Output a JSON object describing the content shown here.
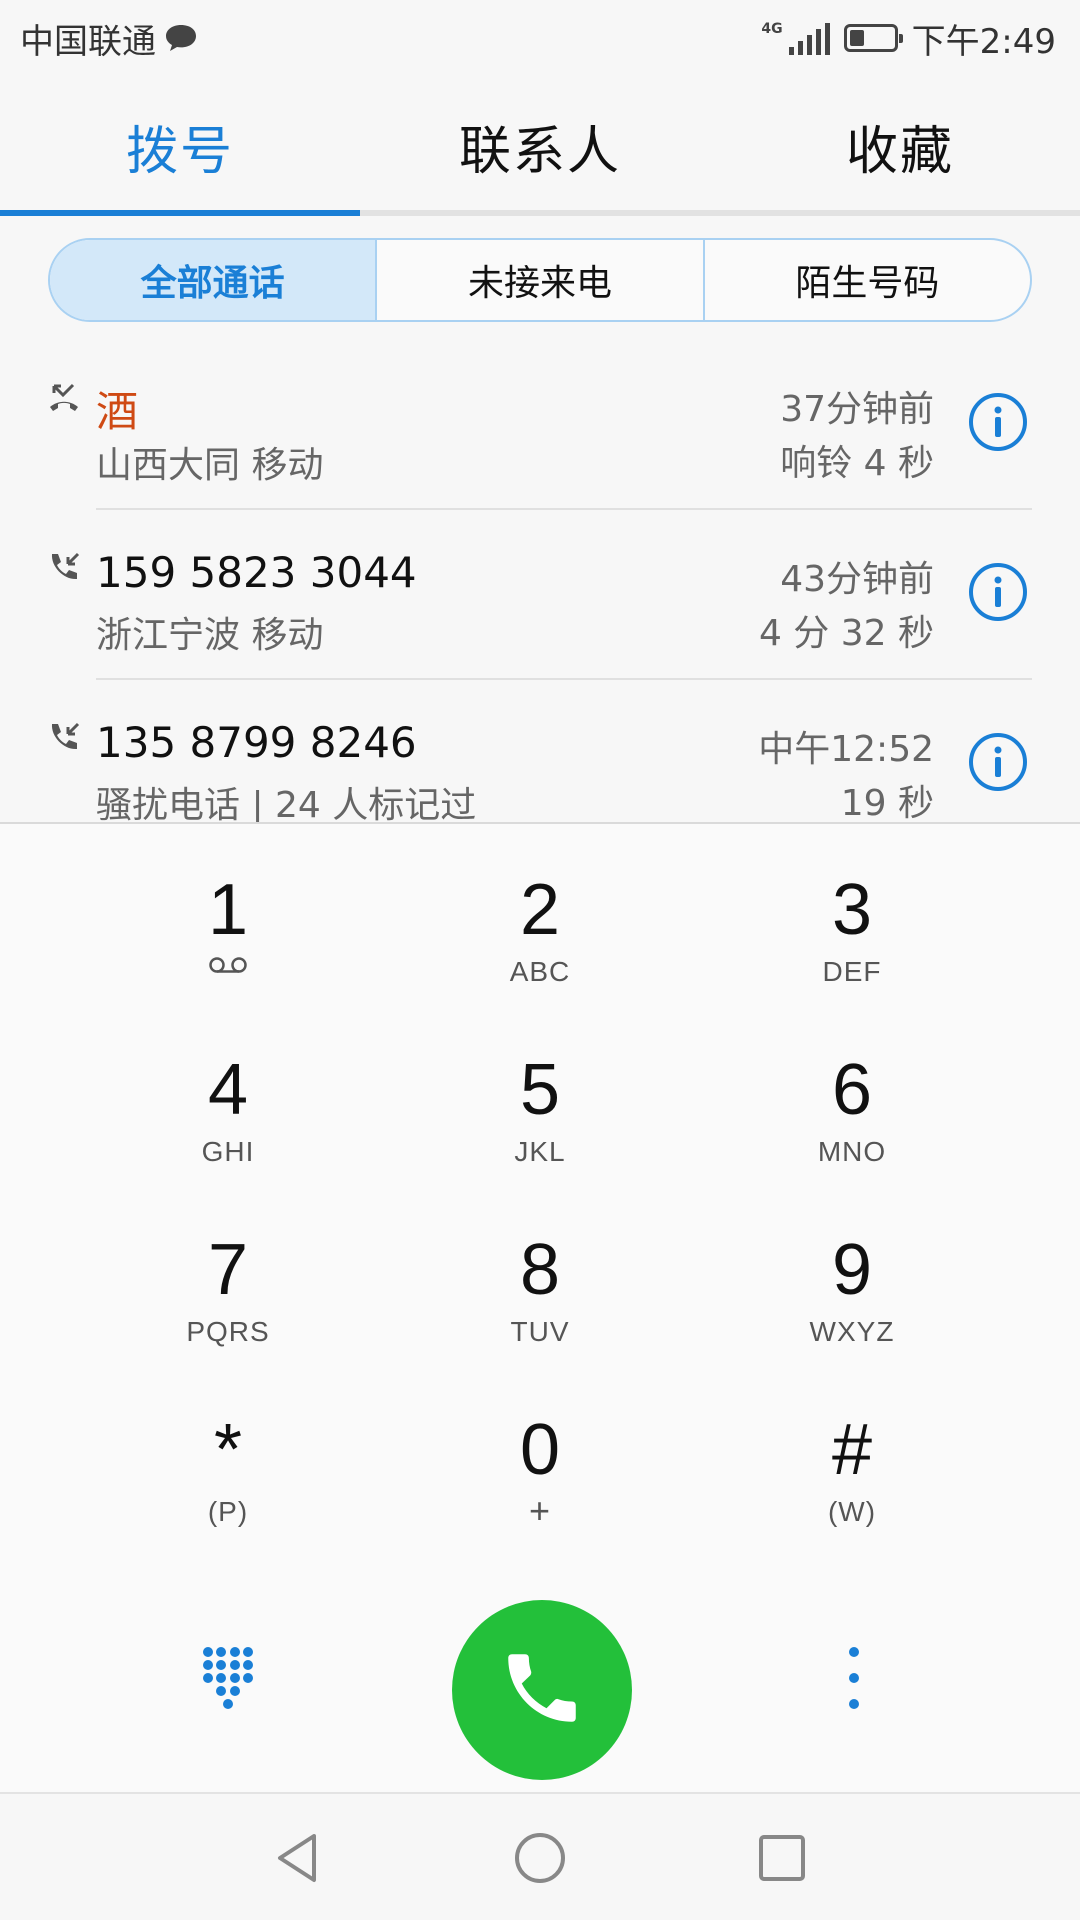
{
  "status_bar": {
    "carrier": "中国联通",
    "network": "4G",
    "time": "下午2:49",
    "battery_level": 0.35
  },
  "tabs": [
    {
      "label": "拨号",
      "active": true
    },
    {
      "label": "联系人",
      "active": false
    },
    {
      "label": "收藏",
      "active": false
    }
  ],
  "filters": [
    {
      "label": "全部通话",
      "active": true
    },
    {
      "label": "未接来电",
      "active": false
    },
    {
      "label": "陌生号码",
      "active": false
    }
  ],
  "calls": [
    {
      "name": "酒",
      "location": "山西大同 移动",
      "time": "37分钟前",
      "duration": "响铃 4 秒",
      "type": "missed",
      "icon": "missed-call-icon"
    },
    {
      "name": "159 5823 3044",
      "location": "浙江宁波 移动",
      "time": "43分钟前",
      "duration": "4 分 32 秒",
      "type": "incoming",
      "icon": "incoming-call-icon"
    },
    {
      "name": "135 8799 8246",
      "location": "骚扰电话 | 24 人标记过",
      "time": "中午12:52",
      "duration": "19 秒",
      "type": "incoming",
      "icon": "incoming-call-icon"
    }
  ],
  "keypad": [
    {
      "digit": "1",
      "letters": "",
      "icon": "voicemail-icon"
    },
    {
      "digit": "2",
      "letters": "ABC"
    },
    {
      "digit": "3",
      "letters": "DEF"
    },
    {
      "digit": "4",
      "letters": "GHI"
    },
    {
      "digit": "5",
      "letters": "JKL"
    },
    {
      "digit": "6",
      "letters": "MNO"
    },
    {
      "digit": "7",
      "letters": "PQRS"
    },
    {
      "digit": "8",
      "letters": "TUV"
    },
    {
      "digit": "9",
      "letters": "WXYZ"
    },
    {
      "digit": "*",
      "letters": "(P)"
    },
    {
      "digit": "0",
      "letters": "+"
    },
    {
      "digit": "#",
      "letters": "(W)"
    }
  ],
  "colors": {
    "accent": "#1a7fd6",
    "missed": "#cf4a14",
    "call_button": "#23c03a"
  }
}
